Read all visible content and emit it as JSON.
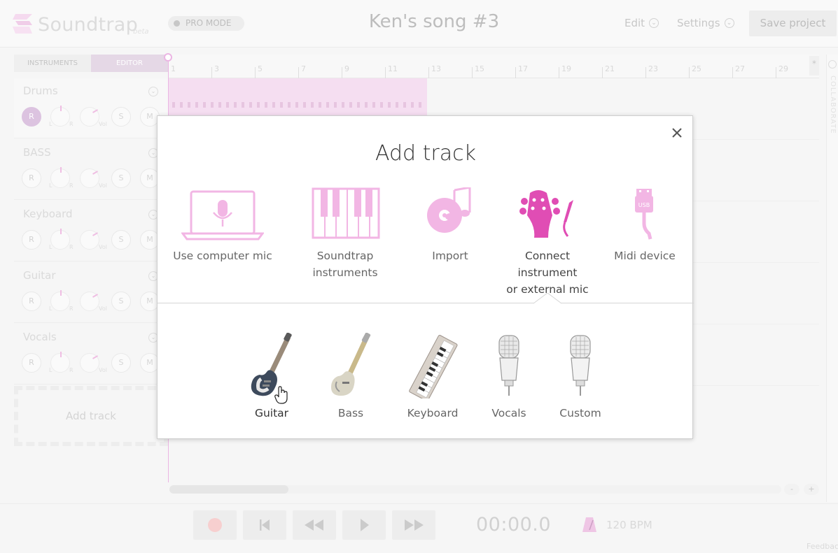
{
  "header": {
    "logo_text": "Soundtrap",
    "logo_beta": "beta",
    "pro_mode": "PRO MODE",
    "song_title": "Ken's song #3",
    "edit_menu": "Edit",
    "settings_menu": "Settings",
    "save_button": "Save project"
  },
  "sidebar": {
    "tabs": [
      "INSTRUMENTS",
      "EDITOR"
    ],
    "tracks": [
      {
        "name": "Drums",
        "rec": "R",
        "pan_left": "L",
        "pan_right": "R",
        "vol": "Vol",
        "solo": "S",
        "mute": "M"
      },
      {
        "name": "BASS",
        "rec": "R",
        "pan_left": "L",
        "pan_right": "R",
        "vol": "Vol",
        "solo": "S",
        "mute": "M"
      },
      {
        "name": "Keyboard",
        "rec": "R",
        "pan_left": "L",
        "pan_right": "R",
        "vol": "Vol",
        "solo": "S",
        "mute": "M"
      },
      {
        "name": "Guitar",
        "rec": "R",
        "pan_left": "L",
        "pan_right": "R",
        "vol": "Vol",
        "solo": "S",
        "mute": "M"
      },
      {
        "name": "Vocals",
        "rec": "R",
        "pan_left": "L",
        "pan_right": "R",
        "vol": "Vol",
        "solo": "S",
        "mute": "M"
      }
    ],
    "add_track": "Add track"
  },
  "timeline": {
    "bar_numbers": [
      "1",
      "3",
      "5",
      "7",
      "9",
      "11",
      "13",
      "15",
      "17",
      "19",
      "21",
      "23",
      "25",
      "27",
      "29"
    ],
    "star": "*",
    "zoom_out": "-",
    "zoom_in": "+",
    "collaborate": "COLLABORATE"
  },
  "transport": {
    "time": "00:00.0",
    "bpm": "120 BPM",
    "feedback": "Feedback"
  },
  "dialog": {
    "title": "Add track",
    "options": [
      {
        "label": "Use computer mic",
        "icon": "laptop-mic-icon"
      },
      {
        "label": "Soundtrap instruments",
        "icon": "piano-keys-icon"
      },
      {
        "label": "Import",
        "icon": "music-disc-icon"
      },
      {
        "label": "Connect instrument\nor external mic",
        "icon": "guitar-head-icon",
        "selected": true
      },
      {
        "label": "Midi device",
        "icon": "usb-cable-icon"
      }
    ],
    "sub_options": [
      {
        "label": "Guitar",
        "icon": "electric-guitar-icon"
      },
      {
        "label": "Bass",
        "icon": "bass-guitar-icon"
      },
      {
        "label": "Keyboard",
        "icon": "keyboard-icon"
      },
      {
        "label": "Vocals",
        "icon": "vocals-mic-icon"
      },
      {
        "label": "Custom",
        "icon": "custom-mic-icon"
      }
    ]
  },
  "colors": {
    "accent_pink": "#e04db4",
    "pink_light": "#f0cdea",
    "editor_tab": "#d7c3d9"
  }
}
